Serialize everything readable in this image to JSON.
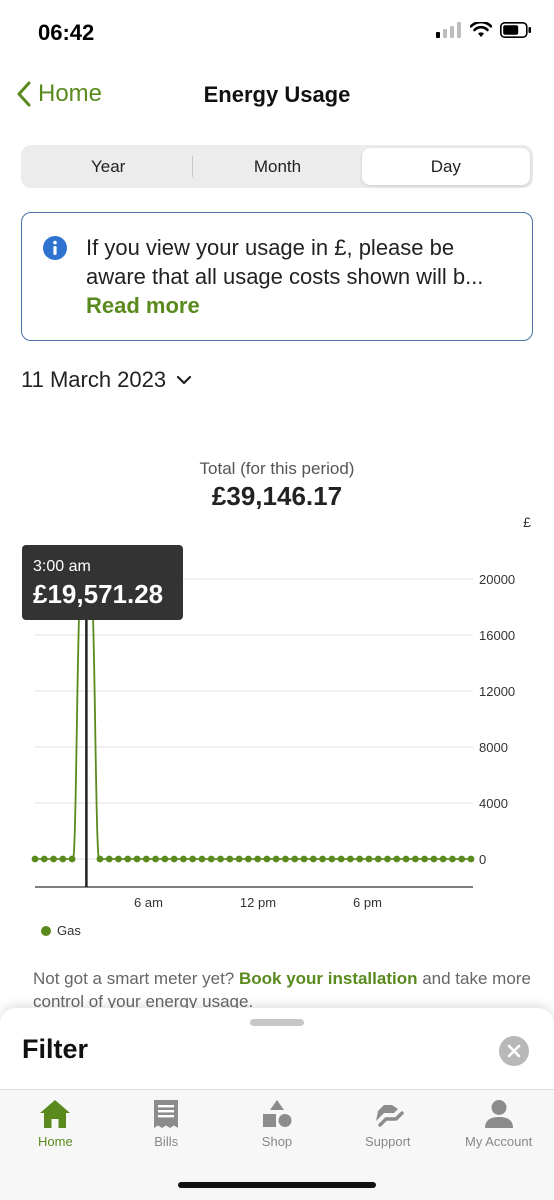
{
  "status": {
    "time": "06:42"
  },
  "nav": {
    "back_label": "Home",
    "title": "Energy Usage"
  },
  "segments": [
    {
      "label": "Year",
      "active": false
    },
    {
      "label": "Month",
      "active": false
    },
    {
      "label": "Day",
      "active": true
    }
  ],
  "info": {
    "text": "If you view your usage in £, please be aware that all usage costs shown will b...",
    "read_more": "Read more"
  },
  "date": {
    "label": "11 March 2023"
  },
  "total": {
    "label": "Total (for this period)",
    "value": "£39,146.17"
  },
  "chart_data": {
    "type": "line",
    "unit": "£",
    "x_ticks": [
      "6 am",
      "12 pm",
      "6 pm"
    ],
    "y_ticks": [
      "20000",
      "16000",
      "12000",
      "8000",
      "4000",
      "0"
    ],
    "ylim": [
      0,
      20000
    ],
    "grid": true,
    "legend_position": "bottom-left",
    "series": [
      {
        "name": "Gas",
        "color": "#5a8a1e",
        "values": [
          0,
          0,
          0,
          0,
          0,
          19571.28,
          19575,
          0,
          0,
          0,
          0,
          0,
          0,
          0,
          0,
          0,
          0,
          0,
          0,
          0,
          0,
          0,
          0,
          0,
          0,
          0,
          0,
          0,
          0,
          0,
          0,
          0,
          0,
          0,
          0,
          0,
          0,
          0,
          0,
          0,
          0,
          0,
          0,
          0,
          0,
          0,
          0,
          0
        ]
      }
    ],
    "tooltip": {
      "time": "3:00 am",
      "value": "£19,571.28",
      "index": 5
    }
  },
  "legend": {
    "label": "Gas",
    "color": "#5a8a1e"
  },
  "promo": {
    "text_before": "Not got a smart meter yet? ",
    "link": "Book your installation",
    "text_after": " and take more control of your energy usage."
  },
  "sheet": {
    "title": "Filter"
  },
  "tabs": [
    {
      "label": "Home",
      "icon": "home-icon",
      "active": true
    },
    {
      "label": "Bills",
      "icon": "bill-icon",
      "active": false
    },
    {
      "label": "Shop",
      "icon": "shapes-icon",
      "active": false
    },
    {
      "label": "Support",
      "icon": "support-icon",
      "active": false
    },
    {
      "label": "My Account",
      "icon": "account-icon",
      "active": false
    }
  ],
  "colors": {
    "accent": "#5a8a1e",
    "info_border": "#4a72a8",
    "info_icon": "#2f73d0"
  }
}
